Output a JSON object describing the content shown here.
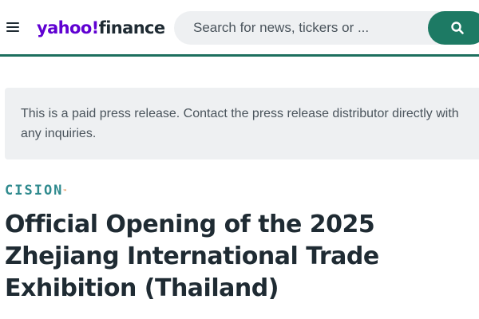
{
  "header": {
    "logo": {
      "part1": "yahoo!",
      "part2": "finance"
    },
    "search": {
      "placeholder": "Search for news, tickers or ..."
    }
  },
  "notice": {
    "text": "This is a paid press release. Contact the press release distributor directly with\nany inquiries."
  },
  "article": {
    "source": "CISION",
    "source_mark": "™",
    "headline": "Official Opening of the 2025 Zhejiang International Trade Exhibition (Thailand)"
  },
  "colors": {
    "brand_purple": "#6001d2",
    "accent_green": "#1d7a64",
    "header_rule": "#1d6f5e",
    "source_teal": "#2f8a8e"
  },
  "icons": {
    "menu": "hamburger-menu-icon",
    "search": "search-icon"
  }
}
